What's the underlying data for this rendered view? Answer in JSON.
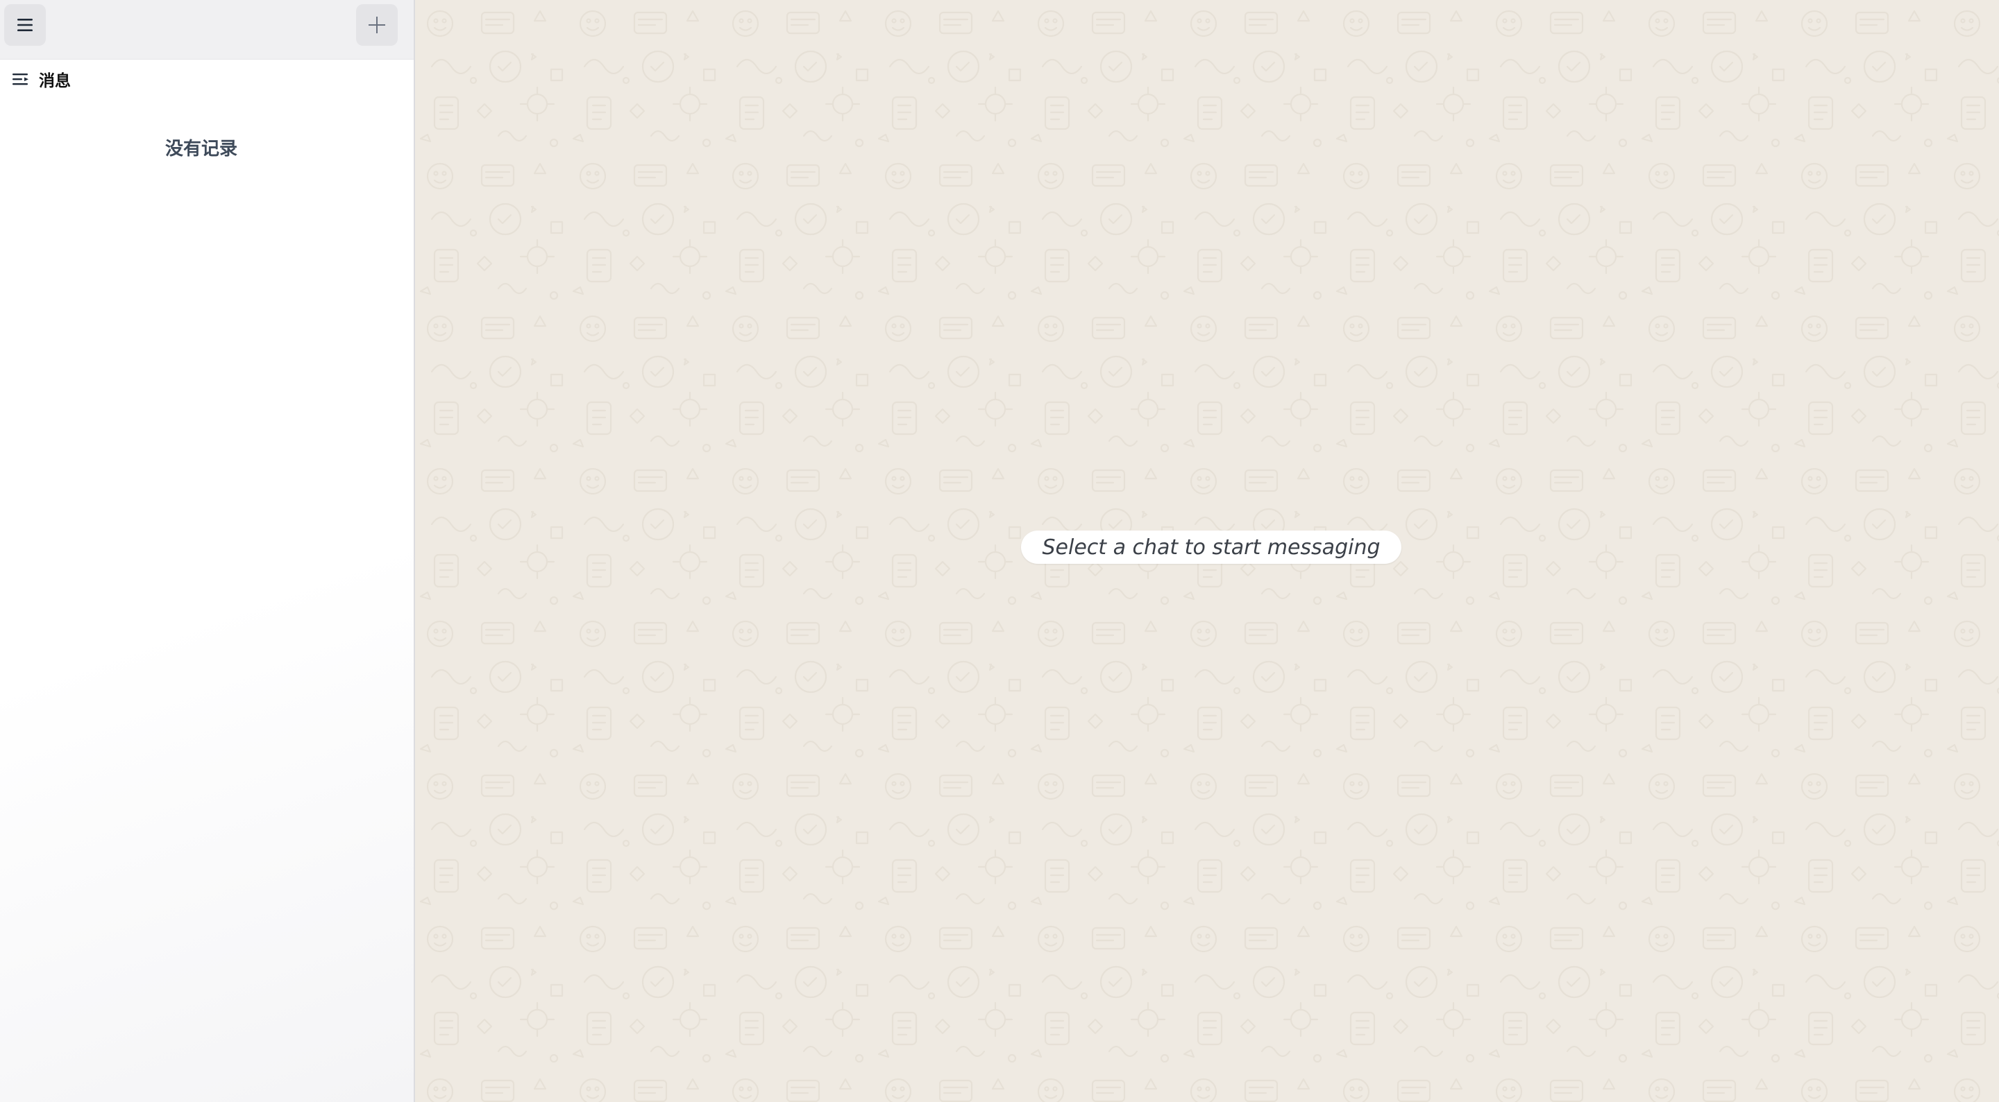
{
  "sidebar": {
    "header": {
      "menu_icon": "hamburger-menu-icon",
      "new_icon": "plus-icon"
    },
    "section": {
      "icon": "sort-list-icon",
      "title": "消息"
    },
    "empty_text": "没有记录"
  },
  "main": {
    "placeholder": "Select a chat to start messaging",
    "wallpaper": "doodle-pattern"
  },
  "colors": {
    "sidebar_header_bg": "#f0f0f2",
    "icon_button_bg": "#e4e4e7",
    "main_bg": "#efeae2",
    "pill_bg": "#ffffff",
    "empty_text": "#3e4a5a"
  }
}
